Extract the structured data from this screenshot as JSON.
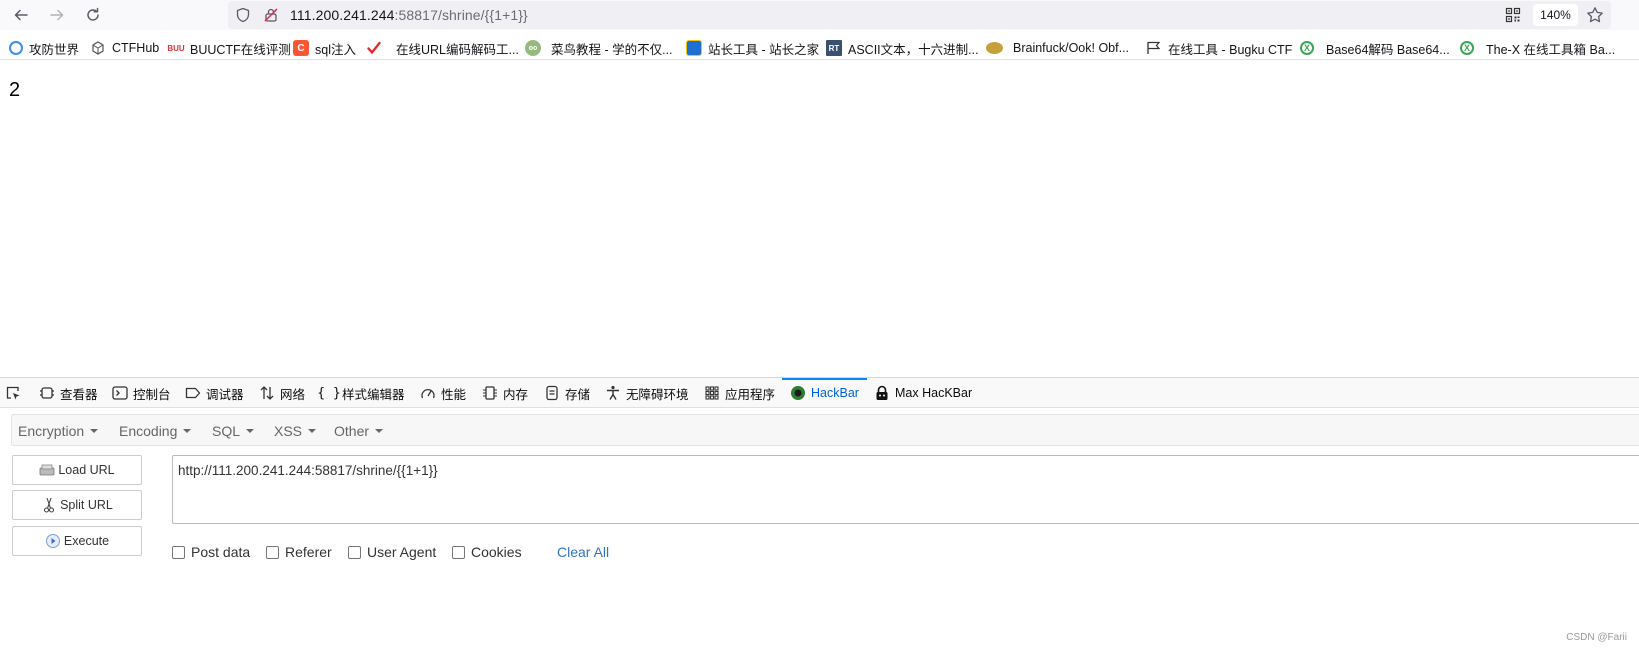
{
  "browser": {
    "url_host": "111.200.241.244",
    "url_rest": ":58817/shrine/{{1+1}}",
    "zoom": "140%"
  },
  "bookmarks": [
    {
      "label": "攻防世界",
      "icon": "globe-icon",
      "color": "#3b8fe0"
    },
    {
      "label": "CTFHub",
      "icon": "cube-icon",
      "color": "#555555"
    },
    {
      "label": "BUUCTF在线评测",
      "icon": "buu-icon",
      "color": "#d9363e"
    },
    {
      "label": "sql注入",
      "icon": "csdn-icon",
      "color": "#fc5531"
    },
    {
      "label": "在线URL编码解码工...",
      "icon": "check-icon",
      "color": "#e8212b"
    },
    {
      "label": "菜鸟教程 - 学的不仅...",
      "icon": "runoob-icon",
      "color": "#96b97d"
    },
    {
      "label": "站长工具 - 站长之家",
      "icon": "chinaz-icon",
      "color": "#1d6fd0"
    },
    {
      "label": "ASCII文本，十六进制...",
      "icon": "rt-icon",
      "color": "#3a5070"
    },
    {
      "label": "Brainfuck/Ook! Obf...",
      "icon": "brain-icon",
      "color": "#c5a03a"
    },
    {
      "label": "在线工具 - Bugku CTF",
      "icon": "flag-icon",
      "color": "#333333"
    },
    {
      "label": "Base64解码 Base64...",
      "icon": "x-icon",
      "color": "#3aa655"
    },
    {
      "label": "The-X 在线工具箱 Ba...",
      "icon": "x-icon",
      "color": "#3aa655"
    }
  ],
  "page": {
    "output": "2"
  },
  "devtools": {
    "tabs": [
      {
        "label": "查看器",
        "icon": "inspector-icon"
      },
      {
        "label": "控制台",
        "icon": "console-icon"
      },
      {
        "label": "调试器",
        "icon": "debugger-icon"
      },
      {
        "label": "网络",
        "icon": "network-icon"
      },
      {
        "label": "样式编辑器",
        "icon": "style-editor-icon"
      },
      {
        "label": "性能",
        "icon": "performance-icon"
      },
      {
        "label": "内存",
        "icon": "memory-icon"
      },
      {
        "label": "存储",
        "icon": "storage-icon"
      },
      {
        "label": "无障碍环境",
        "icon": "accessibility-icon"
      },
      {
        "label": "应用程序",
        "icon": "application-icon"
      },
      {
        "label": "HackBar",
        "icon": "hackbar-icon",
        "active": true
      },
      {
        "label": "Max HacKBar",
        "icon": "max-hackbar-icon"
      }
    ]
  },
  "hackbar": {
    "menus": [
      "Encryption",
      "Encoding",
      "SQL",
      "XSS",
      "Other"
    ],
    "load_url": "Load URL",
    "split_url": "Split URL",
    "execute": "Execute",
    "url_value": "http://111.200.241.244:58817/shrine/{{1+1}}",
    "post_data": "Post data",
    "referer": "Referer",
    "user_agent": "User Agent",
    "cookies": "Cookies",
    "clear_all": "Clear All"
  },
  "watermark": "CSDN @Farii",
  "colors": {
    "accent": "#0060df",
    "link": "#3374c2"
  }
}
